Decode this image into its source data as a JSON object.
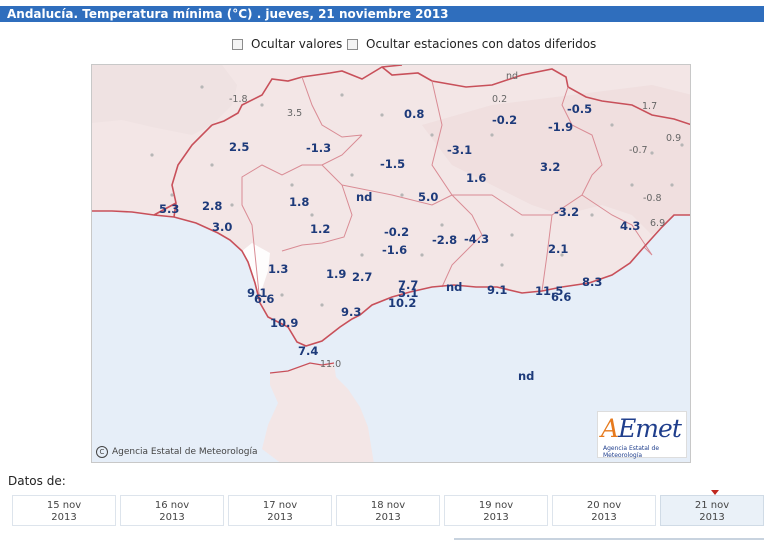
{
  "title": "Andalucía. Temperatura mínima (°C) . jueves, 21 noviembre 2013",
  "options": {
    "hide_values": "Ocultar valores",
    "hide_deferred": "Ocultar estaciones con datos diferidos"
  },
  "map": {
    "copyright": "Agencia Estatal de Meteorología",
    "logo_text": "AEmet",
    "logo_sub": "Agencia Estatal de Meteorología",
    "colors": {
      "sea": "#e6eef8",
      "land": "#f3e9e9",
      "border": "#c8505a",
      "value": "#1d3a7a"
    }
  },
  "stations": [
    {
      "v": "-1.8",
      "grey": true
    },
    {
      "v": "3.5",
      "grey": true
    },
    {
      "v": "nd",
      "grey": true
    },
    {
      "v": "0.2",
      "grey": true
    },
    {
      "v": "1.7",
      "grey": true
    },
    {
      "v": "0.9",
      "grey": true
    },
    {
      "v": "-0.7",
      "grey": true
    },
    {
      "v": "-0.8",
      "grey": true
    },
    {
      "v": "6.9",
      "grey": true
    },
    {
      "v": "11.0",
      "grey": true
    },
    {
      "v": "-0.5"
    },
    {
      "v": "0.8"
    },
    {
      "v": "-0.2"
    },
    {
      "v": "-1.9"
    },
    {
      "v": "2.5"
    },
    {
      "v": "-1.3"
    },
    {
      "v": "-3.1"
    },
    {
      "v": "-1.5"
    },
    {
      "v": "3.2"
    },
    {
      "v": "1.6"
    },
    {
      "v": "nd"
    },
    {
      "v": "5.0"
    },
    {
      "v": "5.3"
    },
    {
      "v": "2.8"
    },
    {
      "v": "1.8"
    },
    {
      "v": "-3.2"
    },
    {
      "v": "3.0"
    },
    {
      "v": "4.3"
    },
    {
      "v": "1.2"
    },
    {
      "v": "-0.2"
    },
    {
      "v": "-2.8"
    },
    {
      "v": "-4.3"
    },
    {
      "v": "-1.6"
    },
    {
      "v": "2.1"
    },
    {
      "v": "1.3"
    },
    {
      "v": "1.9"
    },
    {
      "v": "2.7"
    },
    {
      "v": "7.7"
    },
    {
      "v": "8.3"
    },
    {
      "v": "nd"
    },
    {
      "v": "9.1"
    },
    {
      "v": "11.5"
    },
    {
      "v": "9.1"
    },
    {
      "v": "5.1"
    },
    {
      "v": "6.6"
    },
    {
      "v": "6.6"
    },
    {
      "v": "10.2"
    },
    {
      "v": "9.3"
    },
    {
      "v": "10.9"
    },
    {
      "v": "7.4"
    },
    {
      "v": "nd"
    }
  ],
  "datos_label": "Datos de:",
  "days": [
    {
      "d": "15 nov",
      "y": "2013"
    },
    {
      "d": "16 nov",
      "y": "2013"
    },
    {
      "d": "17 nov",
      "y": "2013"
    },
    {
      "d": "18 nov",
      "y": "2013"
    },
    {
      "d": "19 nov",
      "y": "2013"
    },
    {
      "d": "20 nov",
      "y": "2013"
    },
    {
      "d": "21 nov",
      "y": "2013"
    }
  ]
}
